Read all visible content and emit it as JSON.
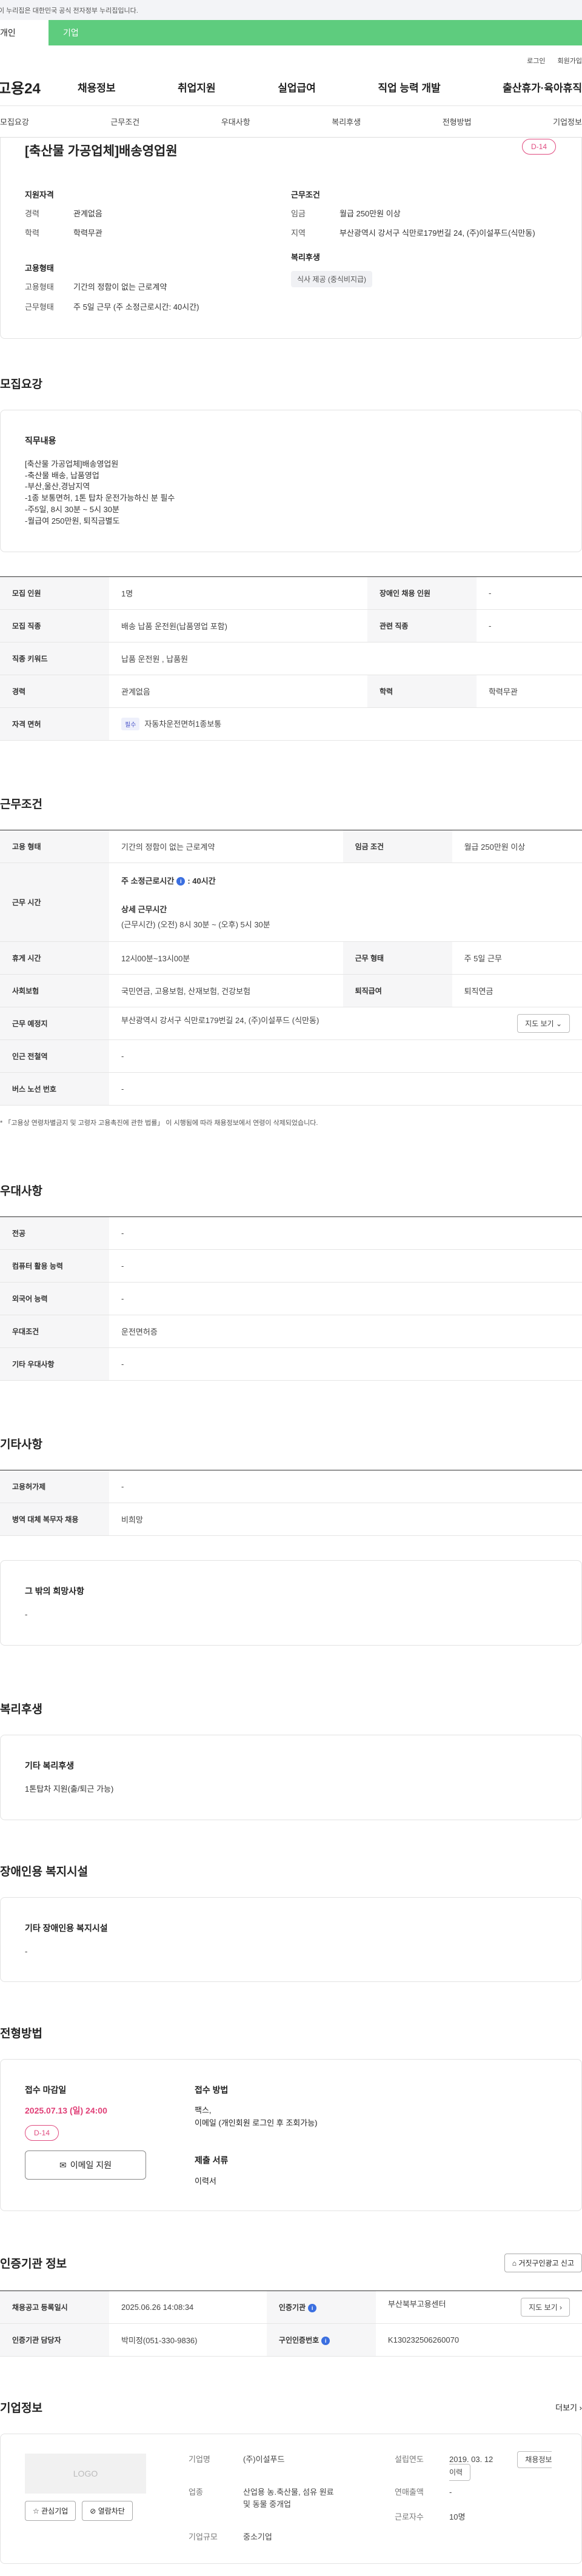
{
  "gov_banner": "이 누리집은 대한민국 공식 전자정부 누리집입니다.",
  "top_tabs": [
    "개인",
    "기업"
  ],
  "util": [
    "로그인",
    "회원가입"
  ],
  "logo": "고용24",
  "gnb": [
    "채용정보",
    "취업지원",
    "실업급여",
    "직업 능력 개발",
    "출산휴가·육아휴직"
  ],
  "subnav": [
    "모집요강",
    "근무조건",
    "우대사항",
    "복리후생",
    "전형방법",
    "기업정보"
  ],
  "hero": {
    "title": "[축산물 가공업체]배송영업원",
    "dday": "D-14",
    "qual_title": "지원자격",
    "qual": [
      {
        "k": "경력",
        "v": "관계없음"
      },
      {
        "k": "학력",
        "v": "학력무관"
      }
    ],
    "work_title": "근무조건",
    "work": [
      {
        "k": "임금",
        "v": "월급 250만원 이상"
      },
      {
        "k": "지역",
        "v": "부산광역시 강서구 식만로179번길 24, (주)이설푸드(식만동)"
      }
    ],
    "emp_title": "고용형태",
    "emp": [
      {
        "k": "고용형태",
        "v": "기간의 정함이 없는 근로계약"
      },
      {
        "k": "근무형태",
        "v": "주 5일 근무 (주 소정근로시간: 40시간)"
      }
    ],
    "welfare_title": "복리후생",
    "welfare_tag": "식사 제공 (중식비지급)"
  },
  "recruit": {
    "section": "모집요강",
    "duty_title": "직무내용",
    "duty": "[축산물 가공업체]배송영업원\n-축산물 배송, 납품영업\n-부산,울산,경남지역\n-1종 보통면허, 1톤 탑차 운전가능하신 분 필수\n-주5일, 8시 30분 ~ 5시 30분\n-월급여 250만원, 퇴직금별도",
    "rows": [
      {
        "k1": "모집 인원",
        "v1": "1명",
        "k2": "장애인 채용 인원",
        "v2": "-"
      },
      {
        "k1": "모집 직종",
        "v1": "배송 납품 운전원(납품영업 포함)",
        "k2": "관련 직종",
        "v2": "-"
      },
      {
        "k1": "직종 키워드",
        "v1": "납품 운전원 , 납품원"
      },
      {
        "k1": "경력",
        "v1": "관계없음",
        "k2": "학력",
        "v2": "학력무관"
      },
      {
        "k1": "자격 면허",
        "pill": "필수",
        "v1": "자동차운전면허1종보통"
      }
    ]
  },
  "work_cond": {
    "section": "근무조건",
    "type_k": "고용 형태",
    "type_v": "기간의 정함이 없는 근로계약",
    "wage_k": "임금 조건",
    "wage_v": "월급 250만원 이상",
    "time_k": "근무 시간",
    "time_main": "주 소정근로시간",
    "time_main_v": ": 40시간",
    "time_detail_t": "상세 근무시간",
    "time_detail": "(근무시간) (오전) 8시 30분 ~ (오후) 5시 30분",
    "rest_k": "휴게 시간",
    "rest_v": "12시00분~13시00분",
    "form_k": "근무 형태",
    "form_v": "주 5일 근무",
    "ins_k": "사회보험",
    "ins_v": "국민연금, 고용보험, 산재보험, 건강보험",
    "ret_k": "퇴직급여",
    "ret_v": "퇴직연금",
    "place_k": "근무 예정지",
    "place_v": "부산광역시 강서구 식만로179번길 24, (주)이설푸드 (식만동)",
    "map_btn": "지도 보기",
    "subway_k": "인근 전철역",
    "subway_v": "-",
    "bus_k": "버스 노선 번호",
    "bus_v": "-",
    "note": "* 「고용상 연령차별금지 및 고령자 고용촉진에 관한 법률」 이 시행됨에 따라 채용정보에서 연령이 삭제되었습니다."
  },
  "pref": {
    "section": "우대사항",
    "rows": [
      {
        "k": "전공",
        "v": "-"
      },
      {
        "k": "컴퓨터 활용 능력",
        "v": "-"
      },
      {
        "k": "외국어 능력",
        "v": "-"
      },
      {
        "k": "우대조건",
        "v": "운전면허증"
      },
      {
        "k": "기타 우대사항",
        "v": "-"
      }
    ]
  },
  "etc": {
    "section": "기타사항",
    "rows": [
      {
        "k": "고용허가제",
        "v": "-"
      },
      {
        "k": "병역 대체 복무자 채용",
        "v": "비희망"
      }
    ],
    "box_title": "그 밖의 희망사항",
    "box_v": "-"
  },
  "welfare": {
    "section": "복리후생",
    "box_title": "기타 복리후생",
    "box_v": "1톤탑차 지원(출/퇴근 가능)"
  },
  "disab": {
    "section": "장애인용 복지시설",
    "box_title": "기타 장애인용 복지시설",
    "box_v": "-"
  },
  "apply": {
    "section": "전형방법",
    "deadline_t": "접수 마감일",
    "deadline": "2025.07.13 (일) 24:00",
    "dday": "D-14",
    "email_btn": "이메일 지원",
    "method_t": "접수 방법",
    "method": "팩스,\n이메일 (개인회원 로그인 후 조회가능)",
    "doc_t": "제출 서류",
    "doc": "이력서"
  },
  "cert": {
    "section": "인증기관 정보",
    "report_btn": "거짓구인광고 신고",
    "rows": [
      {
        "k1": "채용공고 등록일시",
        "v1": "2025.06.26 14:08:34",
        "k2": "인증기관",
        "v2": "부산북부고용센터",
        "btn": "지도 보기"
      },
      {
        "k1": "인증기관 담당자",
        "v1": "박미정(051-330-9836)",
        "k2": "구인인증번호",
        "v2": "K130232506260070"
      }
    ]
  },
  "company": {
    "section": "기업정보",
    "more": "더보기",
    "logo": "LOGO",
    "fav": "관심기업",
    "block": "열람차단",
    "name_k": "기업명",
    "name_v": "(주)이설푸드",
    "year_k": "설립연도",
    "year_v": "2019. 03. 12",
    "job_btn": "채용정보 이력",
    "biz_k": "업종",
    "biz_v": "산업용 농.축산물, 섬유 원료 및 동물 중개업",
    "sales_k": "연매출액",
    "sales_v": "-",
    "emp_k": "근로자수",
    "emp_v": "10명",
    "size_k": "기업규모",
    "size_v": "중소기업"
  }
}
